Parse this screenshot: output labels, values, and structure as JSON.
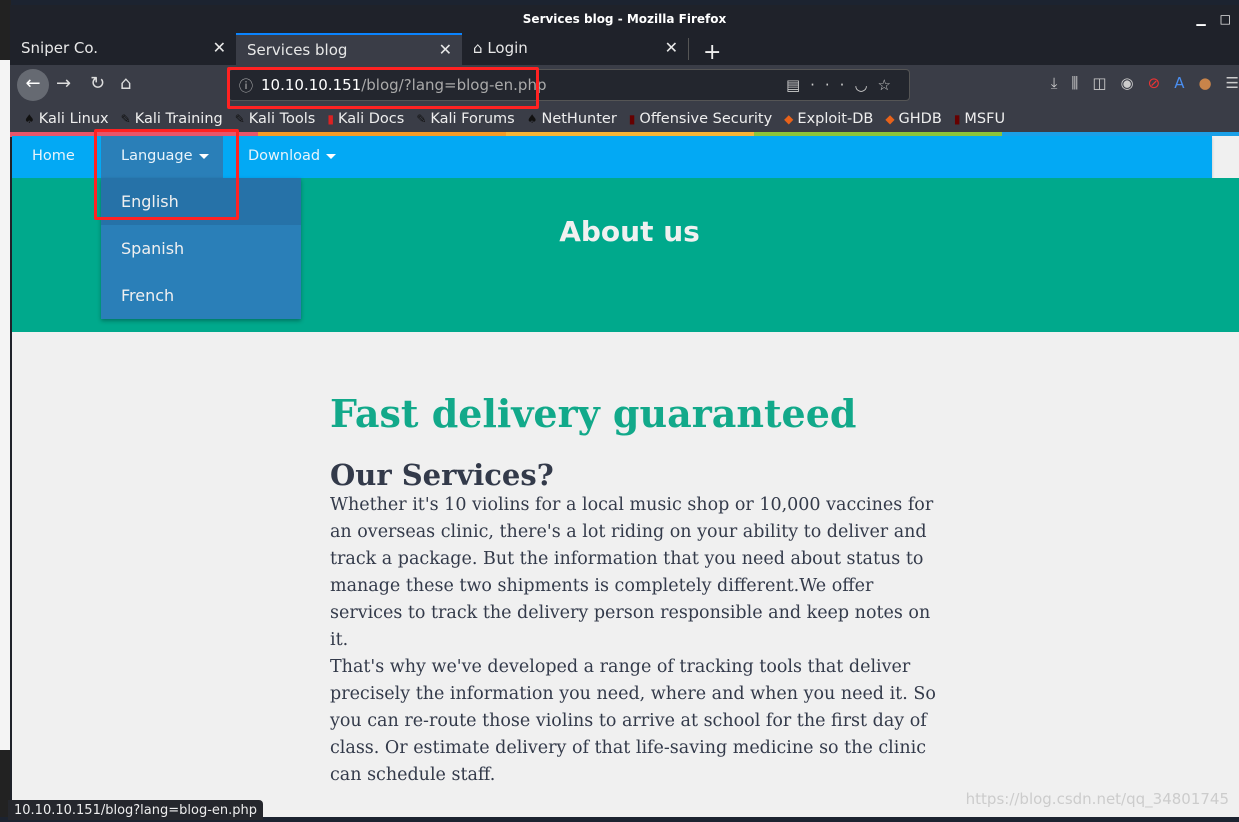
{
  "window": {
    "title": "Services blog - Mozilla Firefox"
  },
  "tabs": [
    {
      "label": "Sniper Co.",
      "active": false
    },
    {
      "label": "Services blog",
      "active": true
    },
    {
      "label": "Login",
      "active": false,
      "icon": "home-icon"
    }
  ],
  "url": {
    "host": "10.10.10.151",
    "path": "/blog/?lang=blog-en.php"
  },
  "bookmarks": [
    {
      "label": "Kali Linux"
    },
    {
      "label": "Kali Training"
    },
    {
      "label": "Kali Tools"
    },
    {
      "label": "Kali Docs"
    },
    {
      "label": "Kali Forums"
    },
    {
      "label": "NetHunter"
    },
    {
      "label": "Offensive Security"
    },
    {
      "label": "Exploit-DB"
    },
    {
      "label": "GHDB"
    },
    {
      "label": "MSFU"
    }
  ],
  "nav": {
    "home": "Home",
    "language": "Language",
    "download": "Download"
  },
  "language_menu": [
    {
      "label": "English",
      "selected": true
    },
    {
      "label": "Spanish"
    },
    {
      "label": "French"
    }
  ],
  "hero": {
    "title": "About us"
  },
  "content": {
    "heading": "Fast delivery guaranteed",
    "subheading": "Our Services?",
    "p1": "Whether it's 10 violins for a local music shop or 10,000 vaccines for an overseas clinic, there's a lot riding on your ability to deliver and track a package. But the information that you need about status to manage these two shipments is completely different.We offer services to track the delivery person responsible and keep notes on it.",
    "p2": "That's why we've developed a range of tracking tools that deliver precisely the information you need, where and when you need it. So you can re-route those violins to arrive at school for the first day of class. Or estimate delivery of that life-saving medicine so the clinic can schedule staff."
  },
  "status_bar": "10.10.10.151/blog?lang=blog-en.php",
  "watermark": "https://blog.csdn.net/qq_34801745",
  "colors": {
    "nav": "#03a9f4",
    "hero": "#00a98c",
    "heading": "#12a98a",
    "dropdown": "#2a7fb8",
    "highlight": "#ff2222"
  }
}
